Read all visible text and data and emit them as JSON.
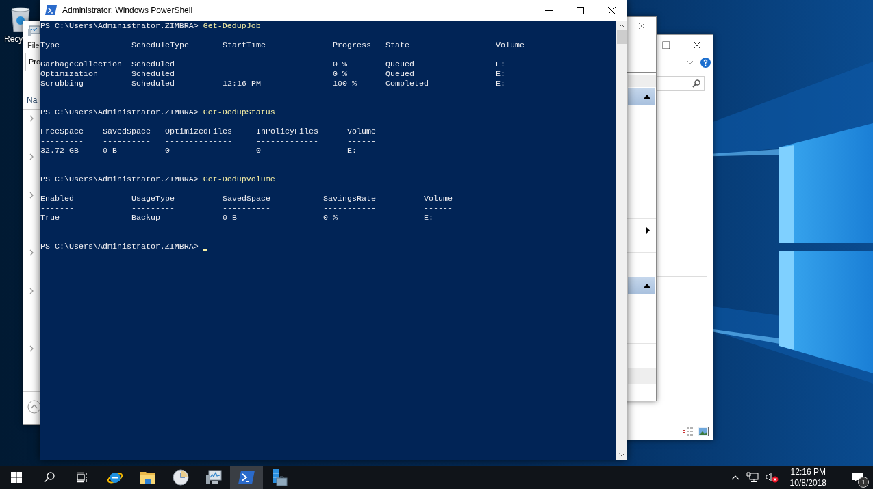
{
  "desktop": {
    "icons": [
      {
        "label": "Recy"
      }
    ]
  },
  "back_window_left": {
    "menu_item": "File",
    "tab": "Pro",
    "column_header": "Na"
  },
  "powershell": {
    "title": "Administrator: Windows PowerShell",
    "blocks": [
      {
        "prompt": "PS C:\\Users\\Administrator.ZIMBRA>",
        "command": "Get-DedupJob",
        "table": {
          "columns": [
            {
              "name": "Type",
              "rule": "----"
            },
            {
              "name": "ScheduleType",
              "rule": "------------"
            },
            {
              "name": "StartTime",
              "rule": "---------"
            },
            {
              "name": "Progress",
              "rule": "--------"
            },
            {
              "name": "State",
              "rule": "-----"
            },
            {
              "name": "Volume",
              "rule": "------"
            }
          ],
          "rows": [
            [
              "GarbageCollection",
              "Scheduled",
              null,
              "0 %",
              "Queued",
              "E:"
            ],
            [
              "Optimization",
              "Scheduled",
              null,
              "0 %",
              "Queued",
              "E:"
            ],
            [
              "Scrubbing",
              "Scheduled",
              "12:16 PM",
              "100 %",
              "Completed",
              "E:"
            ]
          ]
        }
      },
      {
        "prompt": "PS C:\\Users\\Administrator.ZIMBRA>",
        "command": "Get-DedupStatus",
        "table": {
          "columns": [
            {
              "name": "FreeSpace",
              "rule": "---------"
            },
            {
              "name": "SavedSpace",
              "rule": "----------"
            },
            {
              "name": "OptimizedFiles",
              "rule": "--------------"
            },
            {
              "name": "InPolicyFiles",
              "rule": "-------------"
            },
            {
              "name": "Volume",
              "rule": "------"
            }
          ],
          "rows": [
            [
              "32.72 GB",
              "0 B",
              "0",
              "0",
              "E:"
            ]
          ]
        }
      },
      {
        "prompt": "PS C:\\Users\\Administrator.ZIMBRA>",
        "command": "Get-DedupVolume",
        "table": {
          "columns": [
            {
              "name": "Enabled",
              "rule": "-------"
            },
            {
              "name": "UsageType",
              "rule": "---------"
            },
            {
              "name": "SavedSpace",
              "rule": "----------"
            },
            {
              "name": "SavingsRate",
              "rule": "-----------"
            },
            {
              "name": "Volume",
              "rule": "------"
            }
          ],
          "rows": [
            [
              "True",
              "Backup",
              "0 B",
              "0 %",
              "E:"
            ]
          ]
        }
      }
    ],
    "final_prompt": {
      "prompt": "PS C:\\Users\\Administrator.ZIMBRA>",
      "cursor": true
    }
  },
  "taskbar": {
    "apps": [
      {
        "kind": "start",
        "selected": false
      },
      {
        "kind": "search",
        "selected": false
      },
      {
        "kind": "task-view",
        "selected": false
      },
      {
        "kind": "browser",
        "selected": false
      },
      {
        "kind": "folder",
        "selected": false
      },
      {
        "kind": "clock",
        "selected": false
      },
      {
        "kind": "monitor",
        "selected": false
      },
      {
        "kind": "terminal",
        "selected": true
      },
      {
        "kind": "server",
        "selected": false
      }
    ],
    "tray": {
      "muted": true,
      "time": "12:16 PM",
      "date": "10/8/2018",
      "notifications": "1"
    }
  }
}
